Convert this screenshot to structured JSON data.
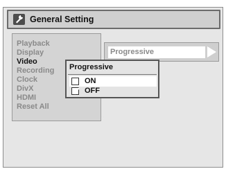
{
  "header": {
    "title": "General Setting",
    "icon": "wrench-icon"
  },
  "menu": {
    "items": [
      {
        "label": "Playback"
      },
      {
        "label": "Display"
      },
      {
        "label": "Video",
        "active": true
      },
      {
        "label": "Recording"
      },
      {
        "label": "Clock"
      },
      {
        "label": "DivX"
      },
      {
        "label": "HDMI"
      },
      {
        "label": "Reset All"
      }
    ]
  },
  "submenu": {
    "label": "Progressive",
    "arrow_icon": "arrow-right-icon"
  },
  "popup": {
    "title": "Progressive",
    "options": [
      {
        "label": "ON",
        "checked": false,
        "highlighted": true
      },
      {
        "label": "OFF",
        "checked": true,
        "highlighted": false
      }
    ]
  }
}
